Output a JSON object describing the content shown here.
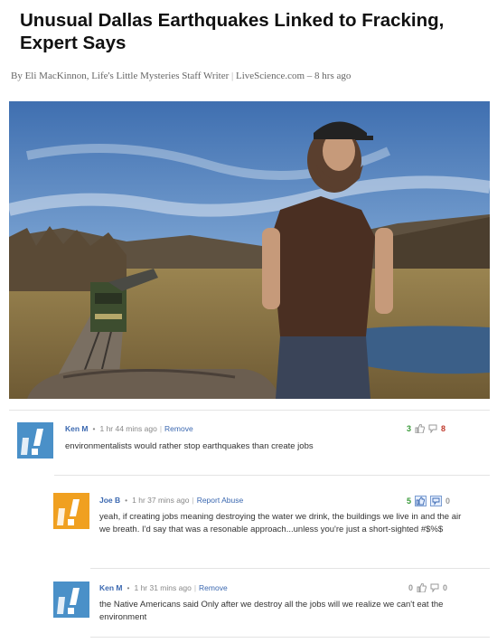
{
  "article": {
    "title": "Unusual Dallas Earthquakes Linked to Fracking, Expert Says",
    "byline": {
      "author": "By Eli MacKinnon, Life's Little Mysteries Staff Writer",
      "separator": "|",
      "source": "LiveScience.com",
      "dash": "–",
      "time": "8 hrs ago"
    }
  },
  "photo": {
    "icon": "photo-man-on-train"
  },
  "comments": [
    {
      "author": "Ken M",
      "time": "1 hr 44 mins ago",
      "action": "Remove",
      "text": "environmentalists would rather stop earthquakes than create jobs",
      "likes": "3",
      "replies": "8",
      "avatar_color": "#4a90c8"
    },
    {
      "author": "Joe B",
      "time": "1 hr 37 mins ago",
      "action": "Report Abuse",
      "text": "yeah, if creating jobs meaning destroying the water we drink, the buildings we live in and the air we breath. I'd say that was a resonable approach...unless you're just a short-sighted #$%$",
      "likes": "5",
      "dislikes": "0",
      "avatar_color": "#f0a020"
    },
    {
      "author": "Ken M",
      "time": "1 hr 31 mins ago",
      "action": "Remove",
      "text": "the Native Americans said Only after we destroy all the jobs will we realize we can't eat the environment",
      "likes": "0",
      "dislikes": "0",
      "avatar_color": "#4a90c8"
    }
  ]
}
